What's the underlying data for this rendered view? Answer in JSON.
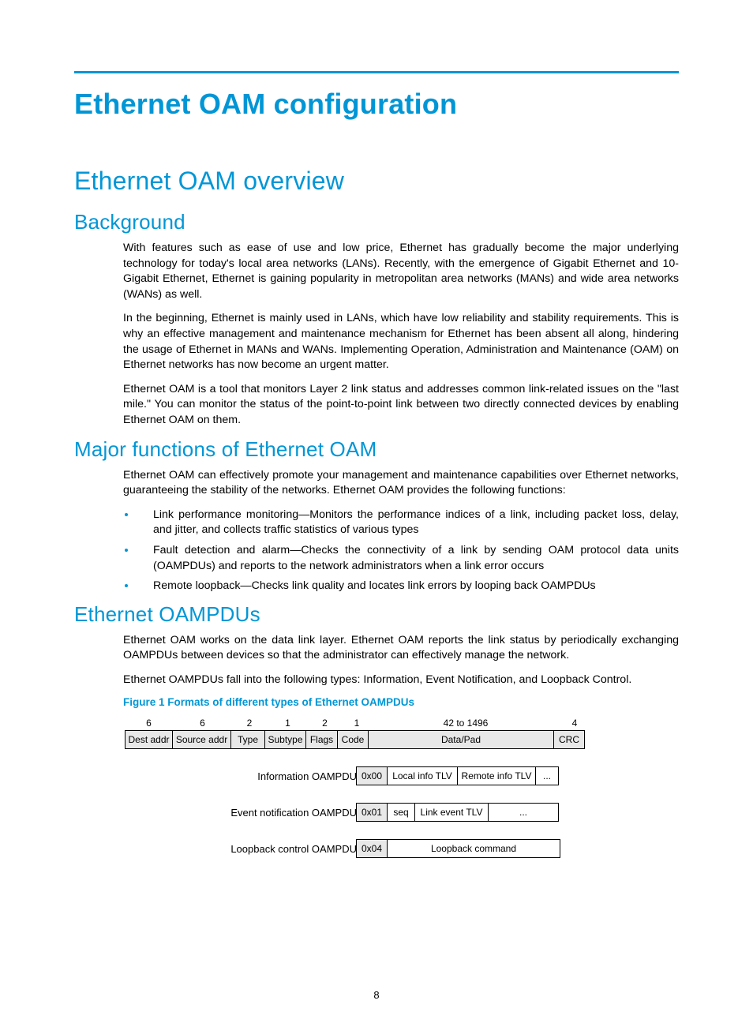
{
  "title": "Ethernet OAM configuration",
  "section_overview": "Ethernet OAM overview",
  "background": {
    "heading": "Background",
    "p1": "With features such as ease of use and low price, Ethernet has gradually become the major underlying technology for today's local area networks (LANs). Recently, with the emergence of Gigabit Ethernet and 10-Gigabit Ethernet, Ethernet is gaining popularity in metropolitan area networks (MANs) and wide area networks (WANs) as well.",
    "p2": "In the beginning, Ethernet is mainly used in LANs, which have low reliability and stability requirements. This is why an effective management and maintenance mechanism for Ethernet has been absent all along, hindering the usage of Ethernet in MANs and WANs. Implementing Operation, Administration and Maintenance (OAM) on Ethernet networks has now become an urgent matter.",
    "p3": "Ethernet OAM is a tool that monitors Layer 2 link status and addresses common link-related issues on the \"last mile.\" You can monitor the status of the point-to-point link between two directly connected devices by enabling Ethernet OAM on them."
  },
  "major": {
    "heading": "Major functions of Ethernet OAM",
    "p1": "Ethernet OAM can effectively promote your management and maintenance capabilities over Ethernet networks, guaranteeing the stability of the networks. Ethernet OAM provides the following functions:",
    "b1": "Link performance monitoring—Monitors the performance indices of a link, including packet loss, delay, and jitter, and collects traffic statistics of various types",
    "b2": "Fault detection and alarm—Checks the connectivity of a link by sending OAM protocol data units (OAMPDUs) and reports to the network administrators when a link error occurs",
    "b3": "Remote loopback—Checks link quality and locates link errors by looping back OAMPDUs"
  },
  "oampdus": {
    "heading": "Ethernet OAMPDUs",
    "p1": "Ethernet OAM works on the data link layer. Ethernet OAM reports the link status by periodically exchanging OAMPDUs between devices so that the administrator can effectively manage the network.",
    "p2": "Ethernet OAMPDUs fall into the following types: Information, Event Notification, and Loopback Control.",
    "figcap": "Figure 1 Formats of different types of Ethernet OAMPDUs"
  },
  "diagram": {
    "top_numbers": {
      "dest": "6",
      "src": "6",
      "type": "2",
      "sub": "1",
      "flags": "2",
      "code": "1",
      "data": "42 to 1496",
      "crc": "4"
    },
    "top_cells": {
      "dest": "Dest addr",
      "src": "Source addr",
      "type": "Type",
      "sub": "Subtype",
      "flags": "Flags",
      "code": "Code",
      "data": "Data/Pad",
      "crc": "CRC"
    },
    "rows": {
      "info": {
        "label": "Information OAMPDU",
        "code": "0x00",
        "c1": "Local info TLV",
        "c2": "Remote info TLV",
        "c3": "..."
      },
      "event": {
        "label": "Event notification  OAMPDU",
        "code": "0x01",
        "c1": "seq",
        "c2": "Link event TLV",
        "c3": "..."
      },
      "loop": {
        "label": "Loopback control OAMPDU",
        "code": "0x04",
        "c1": "Loopback command"
      }
    }
  },
  "page_number": "8"
}
